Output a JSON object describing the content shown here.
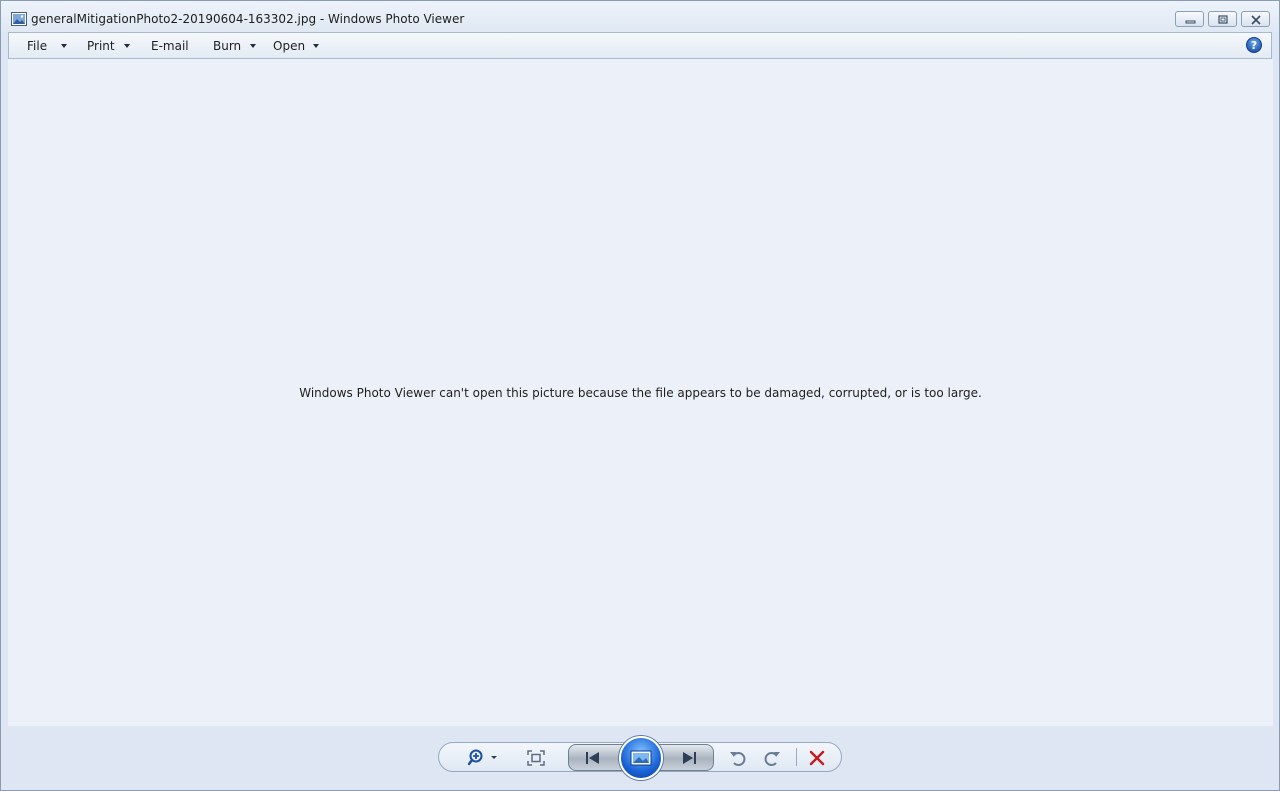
{
  "window": {
    "title": "generalMitigationPhoto2-20190604-163302.jpg - Windows Photo Viewer"
  },
  "menubar": {
    "items": [
      {
        "label": "File",
        "has_dropdown": true
      },
      {
        "label": "Print",
        "has_dropdown": true
      },
      {
        "label": "E-mail",
        "has_dropdown": false
      },
      {
        "label": "Burn",
        "has_dropdown": true
      },
      {
        "label": "Open",
        "has_dropdown": true
      }
    ],
    "help_icon": "help-icon"
  },
  "content": {
    "message": "Windows Photo Viewer can't open this picture because the file appears to be damaged, corrupted, or is too large."
  },
  "toolbar": {
    "buttons": [
      {
        "name": "zoom-icon"
      },
      {
        "name": "actual-size-icon"
      },
      {
        "name": "previous-icon"
      },
      {
        "name": "slideshow-icon"
      },
      {
        "name": "next-icon"
      },
      {
        "name": "rotate-counterclockwise-icon"
      },
      {
        "name": "rotate-clockwise-icon"
      },
      {
        "name": "delete-icon"
      }
    ]
  },
  "colors": {
    "content_bg": "#ecf1f9",
    "delete_red": "#c8161d",
    "accent_blue": "#1a63d6"
  }
}
